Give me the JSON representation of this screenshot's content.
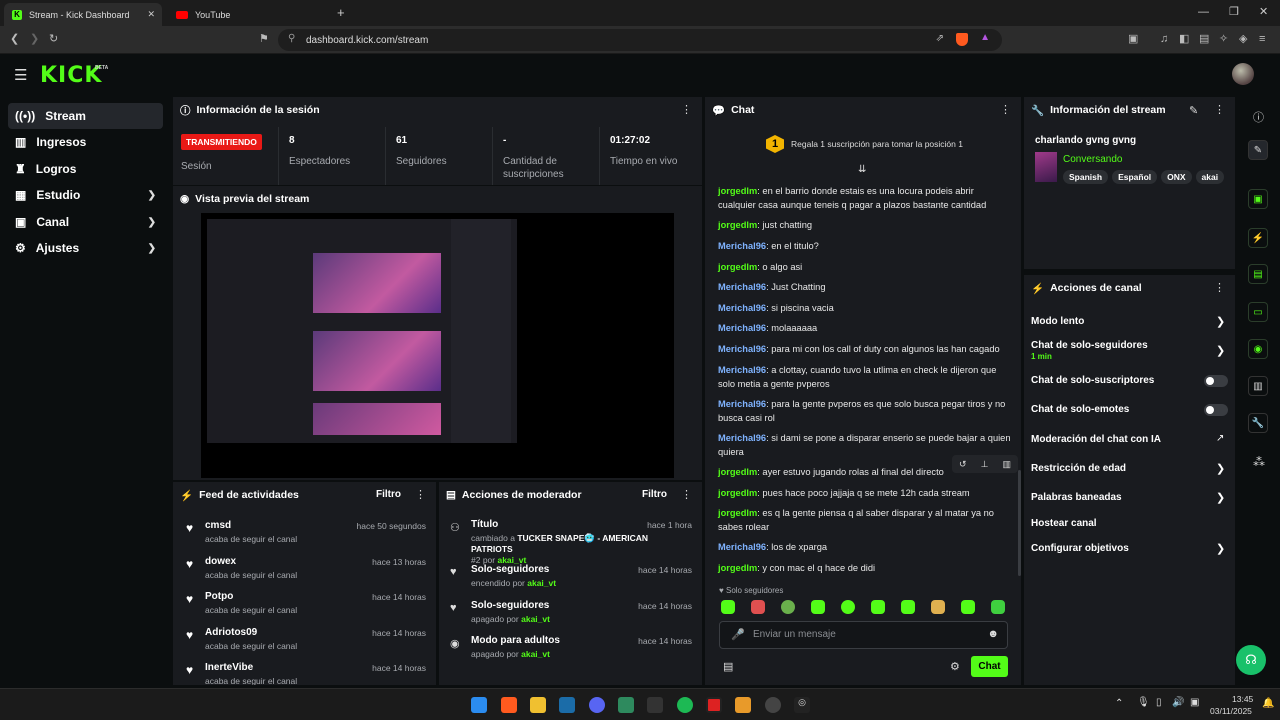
{
  "browser": {
    "tabs": [
      {
        "title": "Stream - Kick Dashboard"
      },
      {
        "title": "YouTube"
      }
    ],
    "new_tab": "+",
    "url": "dashboard.kick.com/stream"
  },
  "brand": {
    "logo": "KICK",
    "badge": "BETA"
  },
  "sidebar": {
    "items": [
      {
        "label": "Stream",
        "icon": "broadcast-icon"
      },
      {
        "label": "Ingresos",
        "icon": "bank-icon"
      },
      {
        "label": "Logros",
        "icon": "trophy-icon"
      },
      {
        "label": "Estudio",
        "icon": "layout-icon"
      },
      {
        "label": "Canal",
        "icon": "channel-icon"
      },
      {
        "label": "Ajustes",
        "icon": "gear-icon"
      }
    ]
  },
  "session": {
    "title": "Información de la sesión",
    "status_badge": "TRANSMITIENDO",
    "status_label": "Sesión",
    "stats": [
      {
        "value": "8",
        "label": "Espectadores"
      },
      {
        "value": "61",
        "label": "Seguidores"
      },
      {
        "value": "-",
        "label": "Cantidad de suscripciones"
      },
      {
        "value": "01:27:02",
        "label": "Tiempo en vivo"
      }
    ]
  },
  "preview": {
    "title": "Vista previa del stream"
  },
  "activity": {
    "title": "Feed de actividades",
    "filter": "Filtro",
    "items": [
      {
        "name": "cmsd",
        "sub": "acaba de seguir el canal",
        "time": "hace 50 segundos"
      },
      {
        "name": "dowex",
        "sub": "acaba de seguir el canal",
        "time": "hace 13 horas"
      },
      {
        "name": "Potpo",
        "sub": "acaba de seguir el canal",
        "time": "hace 14 horas"
      },
      {
        "name": "Adriotos09",
        "sub": "acaba de seguir el canal",
        "time": "hace 14 horas"
      },
      {
        "name": "InerteVibe",
        "sub": "acaba de seguir el canal",
        "time": "hace 14 horas"
      }
    ]
  },
  "modactions": {
    "title": "Acciones de moderador",
    "filter": "Filtro",
    "items": [
      {
        "name": "Título",
        "line1": "cambiado a ",
        "bold": "TUCKER SNAPE🥶 - AMERICAN PATRIOTS",
        "line2": "#2 por ",
        "user": "akai_vt",
        "time": "hace 1 hora",
        "icon": "user-edit-icon"
      },
      {
        "name": "Solo-seguidores",
        "line1": "encendido por ",
        "user": "akai_vt",
        "time": "hace 14 horas",
        "icon": "heart-icon"
      },
      {
        "name": "Solo-seguidores",
        "line1": "apagado por ",
        "user": "akai_vt",
        "time": "hace 14 horas",
        "icon": "heart-icon"
      },
      {
        "name": "Modo para adultos",
        "line1": "apagado por ",
        "user": "akai_vt",
        "time": "hace 14 horas",
        "icon": "eye-icon"
      }
    ]
  },
  "chat": {
    "title": "Chat",
    "gift_rank": "1",
    "gift_text": "Regala 1 suscripción para tomar la posición 1",
    "messages": [
      {
        "user": "jorgedlm",
        "text": ": en el barrio donde estais es una locura podeis abrir cualquier casa aunque teneis q pagar a plazos bastante cantidad"
      },
      {
        "user": "jorgedlm",
        "text": ": just chatting"
      },
      {
        "user": "Merichal96",
        "text": ": en el titulo?"
      },
      {
        "user": "jorgedlm",
        "text": ": o algo asi"
      },
      {
        "user": "Merichal96",
        "text": ": Just Chatting"
      },
      {
        "user": "Merichal96",
        "text": ": si piscina vacia"
      },
      {
        "user": "Merichal96",
        "text": ": molaaaaaa"
      },
      {
        "user": "Merichal96",
        "text": ": para mi con los call of duty con algunos las han cagado"
      },
      {
        "user": "Merichal96",
        "text": ": a clottay, cuando tuvo la utlima en check le dijeron que solo metia a gente pvperos"
      },
      {
        "user": "Merichal96",
        "text": ": para la gente pvperos es que solo busca pegar tiros y no busca casi rol"
      },
      {
        "user": "Merichal96",
        "text": ": si dami se pone a disparar enserio se puede bajar a quien quiera"
      },
      {
        "user": "jorgedlm",
        "text": ": ayer estuvo jugando rolas al final del directo"
      },
      {
        "user": "jorgedlm",
        "text": ": pues hace poco jajjaja q se mete 12h cada stream"
      },
      {
        "user": "jorgedlm",
        "text": ": es q la gente piensa q al saber disparar y al matar ya no sabes rolear"
      },
      {
        "user": "Merichal96",
        "text": ": los de xparga"
      },
      {
        "user": "jorgedlm",
        "text": ": y con mac el q hace de didi"
      }
    ],
    "followers_only": "Solo seguidores",
    "input_placeholder": "Enviar un mensaje",
    "send": "Chat"
  },
  "streaminfo": {
    "title": "Información del stream",
    "stream_title": "charlando gvng gvng",
    "category": "Conversando",
    "tags": [
      "Spanish",
      "Español",
      "ONX",
      "akai"
    ]
  },
  "channel_actions": {
    "title": "Acciones de canal",
    "items": [
      {
        "label": "Modo lento",
        "control": "chevron"
      },
      {
        "label": "Chat de solo-seguidores",
        "sub": "1 min",
        "control": "chevron"
      },
      {
        "label": "Chat de solo-suscriptores",
        "control": "toggle",
        "on": false
      },
      {
        "label": "Chat de solo-emotes",
        "control": "toggle",
        "on": false
      },
      {
        "label": "Moderación del chat con IA",
        "control": "external"
      },
      {
        "label": "Restricción de edad",
        "control": "chevron"
      },
      {
        "label": "Palabras baneadas",
        "control": "chevron"
      },
      {
        "label": "Hostear canal",
        "control": "none"
      },
      {
        "label": "Configurar objetivos",
        "control": "chevron"
      }
    ]
  },
  "taskbar": {
    "time": "13:45",
    "date": "03/11/2025"
  },
  "colors": {
    "accent": "#53fc18",
    "live": "#e91916",
    "panel": "#191b1f",
    "bg": "#0b0e0f"
  }
}
